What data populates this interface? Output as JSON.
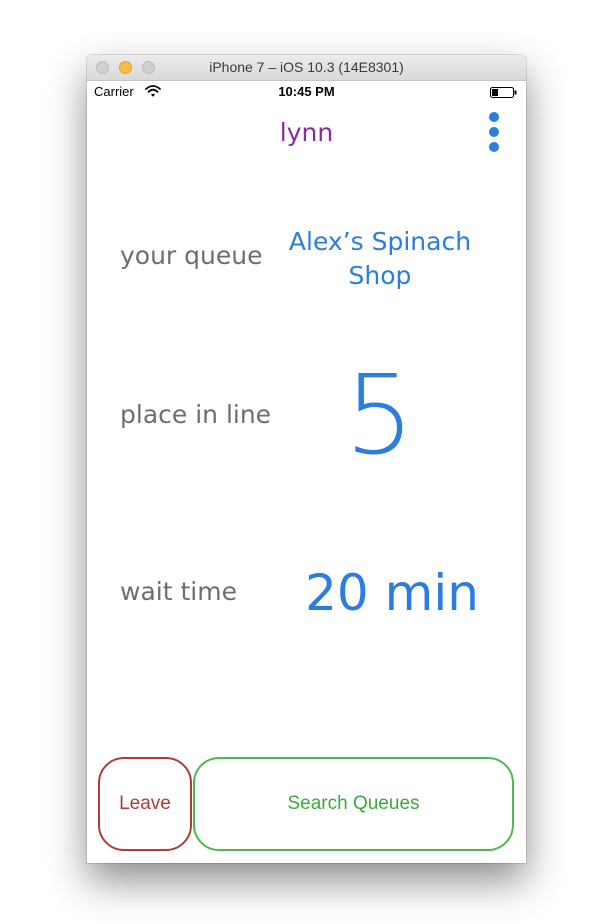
{
  "window": {
    "title": "iPhone 7 – iOS 10.3 (14E8301)"
  },
  "status_bar": {
    "carrier": "Carrier",
    "time": "10:45 PM"
  },
  "nav": {
    "title": "lynn"
  },
  "rows": {
    "queue_label": "your queue",
    "queue_name": "Alex’s Spinach Shop",
    "place_label": "place in line",
    "place_value": "5",
    "wait_label": "wait time",
    "wait_value": "20 min"
  },
  "buttons": {
    "leave": "Leave",
    "search": "Search Queues"
  },
  "colors": {
    "accent_blue": "#2b7de0",
    "title_purple": "#8b2b9e",
    "leave_red": "#b13b3b",
    "search_green": "#4bbb4b",
    "label_gray": "#6e6e6e"
  },
  "icons": [
    "wifi-icon",
    "battery-icon",
    "more-vertical-icon"
  ]
}
